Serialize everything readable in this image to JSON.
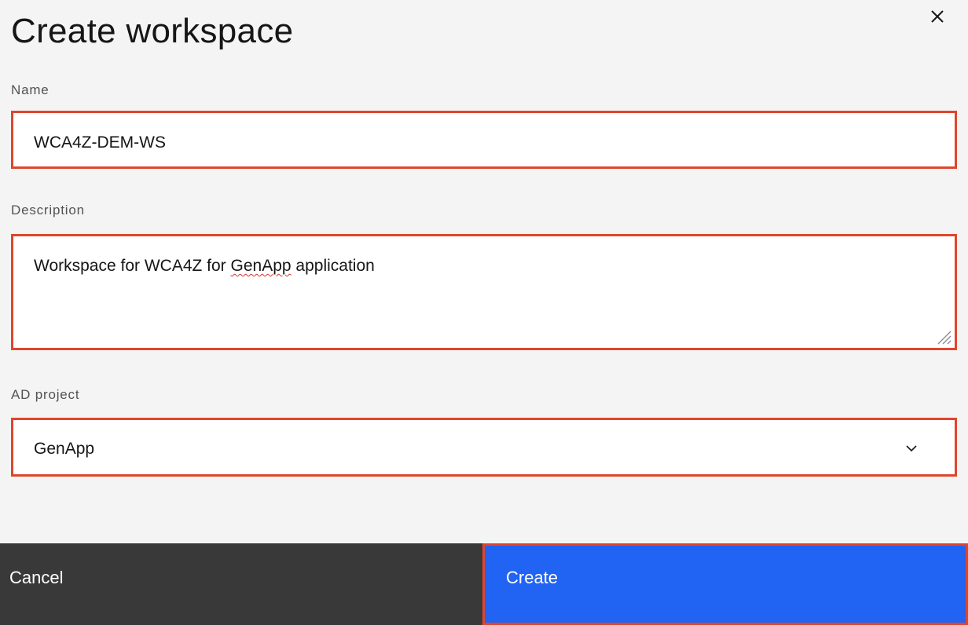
{
  "dialog": {
    "title": "Create workspace",
    "close_icon": "close-icon"
  },
  "form": {
    "name": {
      "label": "Name",
      "value": "WCA4Z-DEM-WS"
    },
    "description": {
      "label": "Description",
      "value_prefix": "Workspace for WCA4Z for ",
      "value_misspelled": "GenApp",
      "value_suffix": " application"
    },
    "ad_project": {
      "label": "AD project",
      "selected": "GenApp",
      "icon": "chevron-down-icon"
    }
  },
  "footer": {
    "cancel_label": "Cancel",
    "create_label": "Create"
  },
  "colors": {
    "highlight_border": "#e0452b",
    "primary_button": "#2163f3",
    "secondary_button": "#393939",
    "background": "#f4f4f4"
  }
}
